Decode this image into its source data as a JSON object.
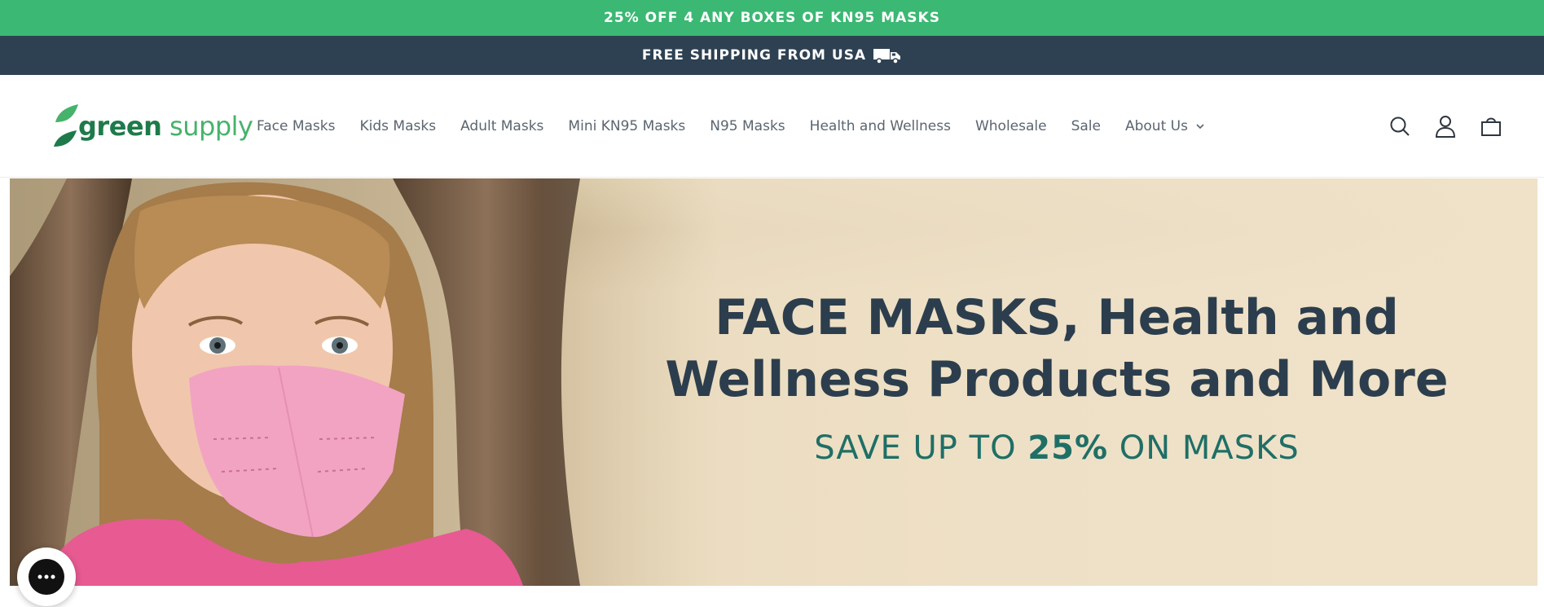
{
  "promo": {
    "text": "25% OFF 4 ANY BOXES OF KN95 MASKS"
  },
  "shipping": {
    "text": "FREE SHIPPING FROM USA",
    "icon": "truck-icon"
  },
  "header": {
    "logo": {
      "part1": "green",
      "part2": " supply"
    },
    "nav": [
      {
        "label": "Face Masks"
      },
      {
        "label": "Kids Masks"
      },
      {
        "label": "Adult Masks"
      },
      {
        "label": "Mini KN95 Masks"
      },
      {
        "label": "N95 Masks"
      },
      {
        "label": "Health and Wellness"
      },
      {
        "label": "Wholesale"
      },
      {
        "label": "Sale"
      },
      {
        "label": "About Us",
        "icon": "chevron-down-icon"
      }
    ],
    "icons": [
      "search-icon",
      "account-icon",
      "cart-icon"
    ]
  },
  "hero": {
    "headline_line1": "FACE MASKS, Health and",
    "headline_line2": "Wellness Products and More",
    "sub_prefix": "SAVE UP TO ",
    "sub_bold": "25%",
    "sub_suffix": " ON MASKS"
  },
  "chat": {
    "icon": "chat-bubble-icon"
  },
  "colors": {
    "promo_bg": "#3bb873",
    "shipping_bg": "#2e4152",
    "headline": "#2c3e4d",
    "subheadline": "#1f6f66",
    "brand_green": "#47b26b"
  }
}
